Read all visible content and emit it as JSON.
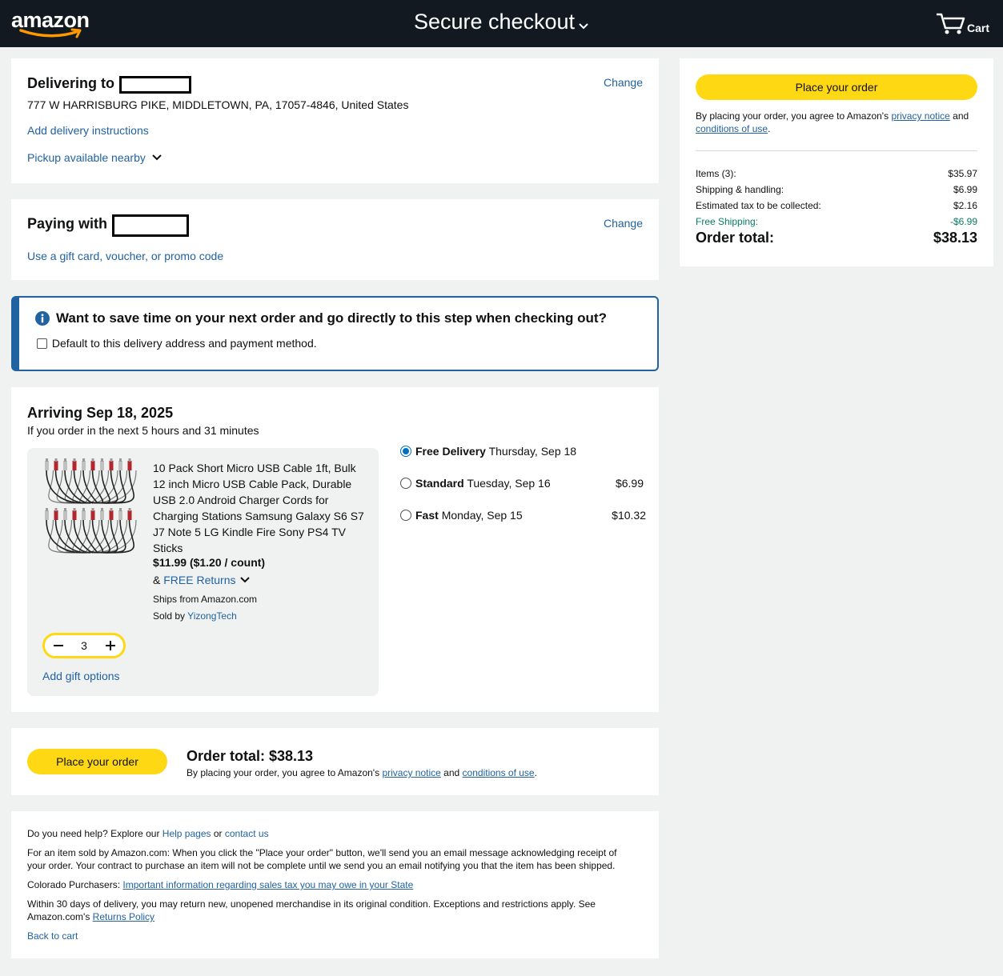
{
  "header": {
    "logo": "amazon",
    "title": "Secure checkout",
    "cart_label": "Cart"
  },
  "delivery": {
    "heading": "Delivering to",
    "address": "777 W HARRISBURG PIKE, MIDDLETOWN, PA, 17057-4846, United States",
    "change": "Change",
    "add_instructions": "Add delivery instructions",
    "pickup": "Pickup available nearby"
  },
  "payment": {
    "heading": "Paying with",
    "change": "Change",
    "gift_card": "Use a gift card, voucher, or promo code"
  },
  "save_time": {
    "question": "Want to save time on your next order and go directly to this step when checking out?",
    "checkbox_label": "Default to this delivery address and payment method."
  },
  "arrival": {
    "heading": "Arriving Sep 18, 2025",
    "subtext": "If you order in the next 5 hours and 31 minutes",
    "product": {
      "title_lines": [
        "10 Pack Short Micro USB Cable 1ft, Bulk",
        "12 inch Micro USB Cable Pack, Durable",
        "USB 2.0 Android Charger Cords for",
        "Charging Stations Samsung Galaxy S6 S7",
        "J7 Note 5 LG Kindle Fire Sony PS4 TV",
        "Sticks"
      ],
      "price": "$11.99 ($1.20 / count)",
      "returns_prefix": "&",
      "returns": "FREE Returns",
      "ships_from": "Ships from Amazon.com",
      "sold_by_prefix": "Sold by",
      "seller": "YizongTech",
      "quantity": "3",
      "gift_options": "Add gift options"
    },
    "options": [
      {
        "name": "Free Delivery",
        "date": "Thursday, Sep 18",
        "price": "",
        "selected": true
      },
      {
        "name": "Standard",
        "date": "Tuesday, Sep 16",
        "price": "$6.99",
        "selected": false
      },
      {
        "name": "Fast",
        "date": "Monday, Sep 15",
        "price": "$10.32",
        "selected": false
      }
    ]
  },
  "bottom_order": {
    "button": "Place your order",
    "total": "Order total: $38.13",
    "agree_prefix": "By placing your order, you agree to Amazon's",
    "privacy": "privacy notice",
    "and": "and",
    "conditions": "conditions of use",
    "period": "."
  },
  "footer": {
    "help_prefix": "Do you need help? Explore our",
    "help_pages": "Help pages",
    "or": "or",
    "contact": "contact us",
    "para1_line1": "For an item sold by Amazon.com: When you click the \"Place your order\" button, we'll send you an email message acknowledging receipt of",
    "para1_line2": "your order. Your contract to purchase an item will not be complete until we send you an email notifying you that the item has been shipped.",
    "colorado_prefix": "Colorado Purchasers:",
    "colorado_link": "Important information regarding sales tax you may owe in your State",
    "para3_line1": "Within 30 days of delivery, you may return new, unopened merchandise in its original condition. Exceptions and restrictions apply. See",
    "para3_line2_prefix": "Amazon.com's",
    "returns_policy": "Returns Policy",
    "back_to_cart": "Back to cart"
  },
  "summary": {
    "button": "Place your order",
    "agree_prefix": "By placing your order, you agree to Amazon's",
    "privacy": "privacy notice",
    "and": "and",
    "conditions": "conditions of use",
    "period": ".",
    "rows": [
      {
        "label": "Items (3):",
        "value": "$35.97"
      },
      {
        "label": "Shipping & handling:",
        "value": "$6.99"
      },
      {
        "label": "Estimated tax to be collected:",
        "value": "$2.16"
      },
      {
        "label": "Free Shipping:",
        "value": "-$6.99"
      }
    ],
    "total_label": "Order total:",
    "total_value": "$38.13"
  },
  "colors": {
    "header_bg": "#131921",
    "button_yellow": "#ffd814",
    "link_blue": "#2162a1",
    "info_blue": "#2162a1",
    "free_shipping_green": "#067d62",
    "radio_blue": "#0071c1"
  }
}
